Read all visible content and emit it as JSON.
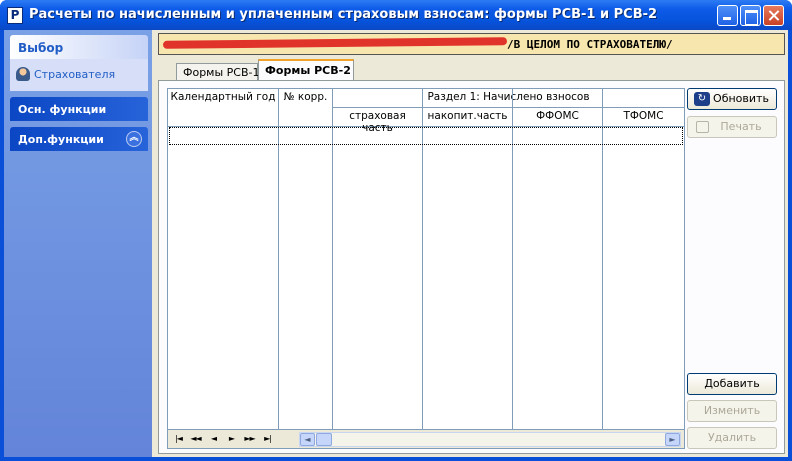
{
  "window": {
    "title": "Расчеты по начисленным и уплаченным страховым взносам: формы РСВ-1 и РСВ-2"
  },
  "taskpane": {
    "group_select": {
      "title": "Выбор",
      "item": "Страхователя"
    },
    "group_main": {
      "title": "Осн. функции"
    },
    "group_extra": {
      "title": "Доп.функции"
    }
  },
  "banner": {
    "visible_text": "/В ЦЕЛОМ ПО СТРАХОВАТЕЛЮ/"
  },
  "tabs": [
    {
      "label": "Формы РСВ-1",
      "active": false
    },
    {
      "label": "Формы РСВ-2",
      "active": true
    }
  ],
  "grid": {
    "columns": {
      "year": "Календартный год",
      "korr": "№ корр.",
      "section_header": "Раздел 1: Начислено взносов",
      "sub": [
        "страховая часть",
        "накопит.часть",
        "ФФОМС",
        "ТФОМС"
      ]
    },
    "rows": [],
    "nav": [
      "|◄",
      "◄◄",
      "◄",
      "►",
      "►►",
      "►|"
    ]
  },
  "buttons": {
    "refresh": "Обновить",
    "print": "Печать",
    "add": "Добавить",
    "edit": "Изменить",
    "delete": "Удалить"
  },
  "colors": {
    "titlebar": "#0653dc",
    "client": "#ece9d8",
    "banner_bg": "#f7e6ad",
    "redaction": "#e0342a",
    "active_tab_accent": "#f0a22a"
  }
}
